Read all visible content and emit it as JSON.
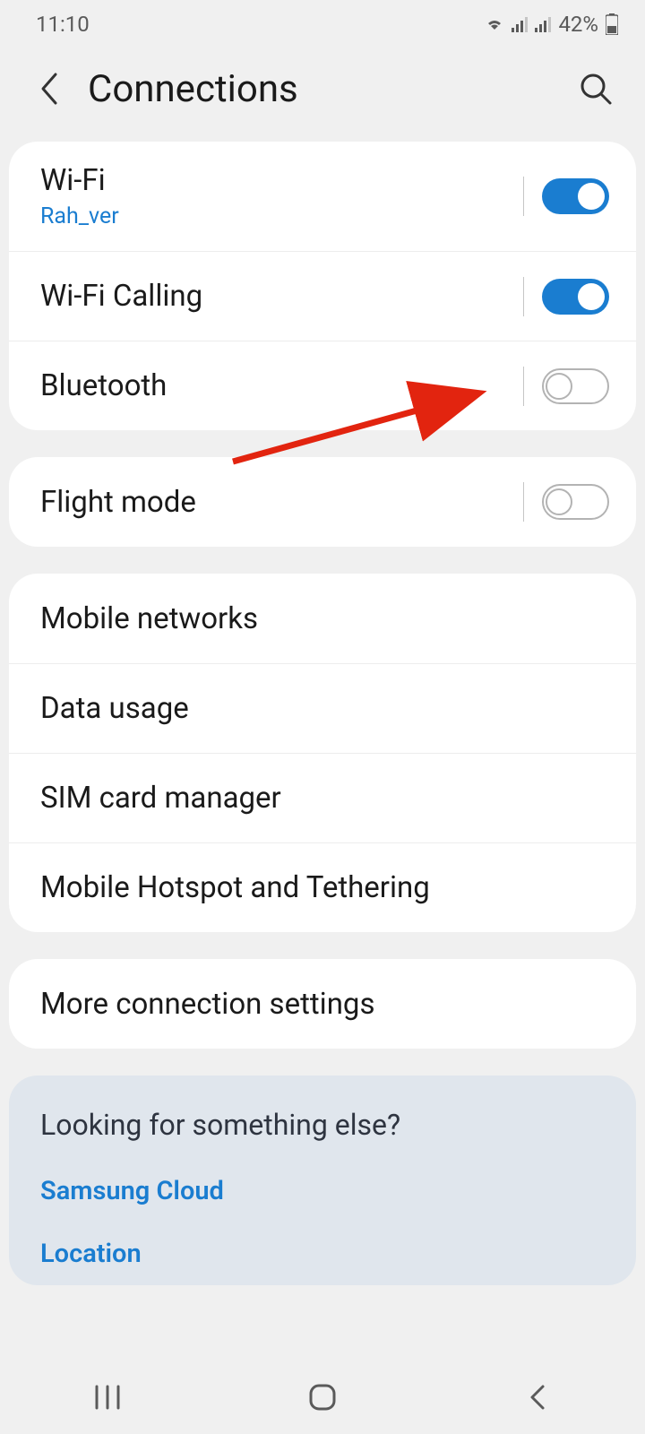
{
  "status": {
    "time": "11:10",
    "battery_text": "42%"
  },
  "header": {
    "title": "Connections"
  },
  "group1": {
    "wifi": {
      "title": "Wi-Fi",
      "subtitle": "Rah_ver",
      "on": true
    },
    "wifi_calling": {
      "title": "Wi-Fi Calling",
      "on": true
    },
    "bluetooth": {
      "title": "Bluetooth",
      "on": false
    }
  },
  "group2": {
    "flight_mode": {
      "title": "Flight mode",
      "on": false
    }
  },
  "group3": {
    "mobile_networks": "Mobile networks",
    "data_usage": "Data usage",
    "sim_manager": "SIM card manager",
    "hotspot": "Mobile Hotspot and Tethering"
  },
  "group4": {
    "more": "More connection settings"
  },
  "suggestions": {
    "heading": "Looking for something else?",
    "samsung_cloud": "Samsung Cloud",
    "location": "Location"
  }
}
